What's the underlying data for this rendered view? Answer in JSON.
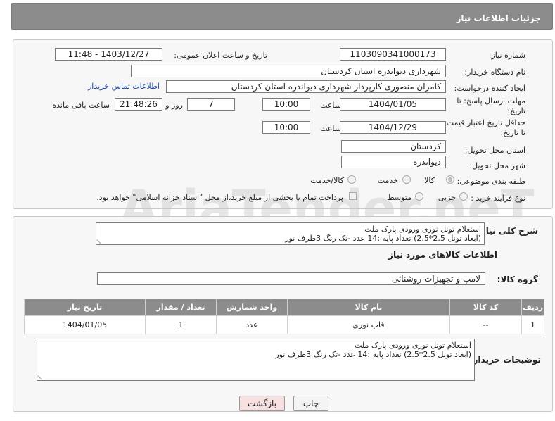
{
  "header": {
    "title": "جزئیات اطلاعات نیاز"
  },
  "fields": {
    "need_number_label": "شماره نیاز:",
    "need_number": "1103090341000173",
    "announce_label": "تاریخ و ساعت اعلان عمومی:",
    "announce_value": "1403/12/27 - 11:48",
    "buyer_org_label": "نام دستگاه خریدار:",
    "buyer_org": "شهرداری دیواندره استان کردستان",
    "creator_label": "ایجاد کننده درخواست:",
    "creator": "کامران منصوری کارپرداز شهرداری دیواندره استان کردستان",
    "contact_link": "اطلاعات تماس خریدار",
    "reply_deadline_label": "مهلت ارسال پاسخ: تا تاریخ:",
    "reply_date": "1404/01/05",
    "time_label": "ساعت",
    "reply_time": "10:00",
    "days_value": "7",
    "days_label": "روز و",
    "remaining_time": "21:48:26",
    "remaining_label": "ساعت باقی مانده",
    "validity_label": "حداقل تاریخ اعتبار قیمت: تا تاریخ:",
    "validity_date": "1404/12/29",
    "validity_time_label": "ساعت",
    "validity_time": "10:00",
    "province_label": "استان محل تحویل:",
    "province": "کردستان",
    "city_label": "شهر محل تحویل:",
    "city": "دیواندره",
    "category_label": "طبقه بندی موضوعی:",
    "category_options": [
      "کالا",
      "خدمت",
      "کالا/خدمت"
    ],
    "process_label": "نوع فرآیند خرید :",
    "process_options": [
      "جزیی",
      "متوسط"
    ],
    "payment_note": "پرداخت تمام یا بخشی از مبلغ خرید،از محل \"اسناد خزانه اسلامی\" خواهد بود."
  },
  "description": {
    "label": "شرح کلی نیاز:",
    "line1": "استعلام تونل نوری ورودی پارک ملت",
    "line2": "(ابعاد تونل 2.5*2.5) تعداد پایه :14 عدد -تک رنگ 3طرف نور"
  },
  "goods": {
    "section_title": "اطلاعات کالاهای مورد نیاز",
    "group_label": "گروه کالا:",
    "group_value": "لامپ و تجهیزات روشنائی",
    "columns": [
      "ردیف",
      "کد کالا",
      "نام کالا",
      "واحد شمارش",
      "تعداد / مقدار",
      "تاریخ نیاز"
    ],
    "rows": [
      {
        "row": "1",
        "code": "--",
        "name": "قاب نوری",
        "unit": "عدد",
        "qty": "1",
        "date": "1404/01/05"
      }
    ]
  },
  "buyer_notes": {
    "label": "توضیحات خریدار:",
    "line1": "استعلام تونل نوری ورودی پارک ملت",
    "line2": "(ابعاد تونل 2.5*2.5) تعداد پایه :14 عدد -تک رنگ 3طرف نور"
  },
  "buttons": {
    "print": "چاپ",
    "back": "بازگشت"
  },
  "watermark": "AriaTender.neT",
  "colors": {
    "header_bg": "#8c8c8c",
    "link": "#1a4aa8",
    "back_button_bg": "#f7e0e0"
  }
}
